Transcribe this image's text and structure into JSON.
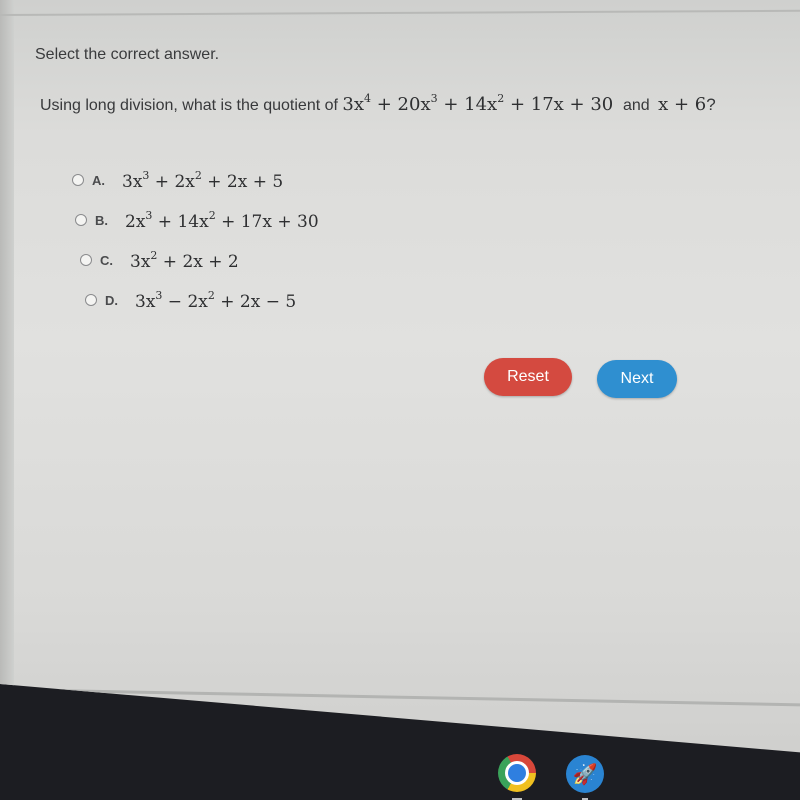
{
  "instruction": "Select the correct answer.",
  "question": {
    "prefix": "Using long division, what is the quotient of",
    "dividend": {
      "t1_coef": "3x",
      "t1_exp": "4",
      "t2_coef": "20x",
      "t2_exp": "3",
      "t3_coef": "14x",
      "t3_exp": "2",
      "rest": "+ 17x + 30"
    },
    "conjunction": "and",
    "divisor": "x + 6",
    "suffix": "?"
  },
  "options": [
    {
      "letter": "A.",
      "parts": [
        "3x",
        "3",
        " + 2x",
        "2",
        " + 2x + 5"
      ]
    },
    {
      "letter": "B.",
      "parts": [
        "2x",
        "3",
        " + 14x",
        "2",
        " + 17x + 30"
      ]
    },
    {
      "letter": "C.",
      "parts": [
        "3x",
        "2",
        " + 2x + 2",
        "",
        ""
      ]
    },
    {
      "letter": "D.",
      "parts": [
        "3x",
        "3",
        " − 2x",
        "2",
        " + 2x − 5"
      ]
    }
  ],
  "buttons": {
    "reset": "Reset",
    "next": "Next"
  },
  "taskbar": {
    "apps": [
      "chrome",
      "rocket-launcher"
    ]
  },
  "colors": {
    "reset": "#d44a40",
    "next": "#2f8fd0"
  }
}
